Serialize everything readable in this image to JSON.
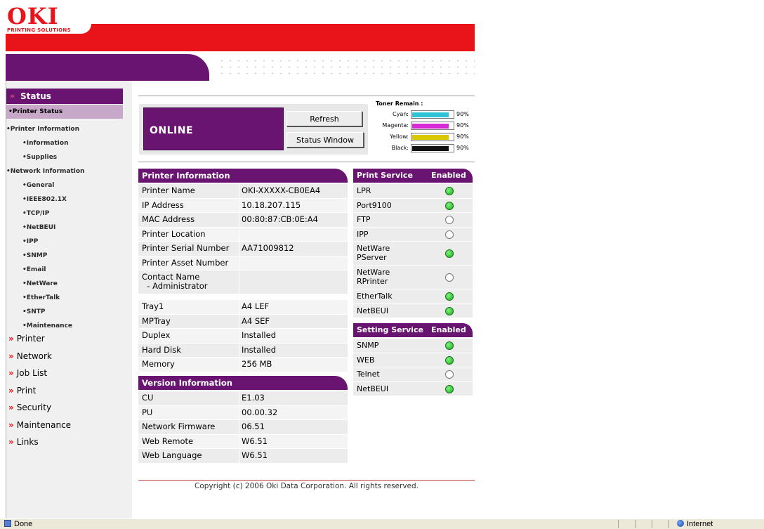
{
  "brand": {
    "logo_text": "OKI",
    "logo_sub": "PRINTING SOLUTIONS"
  },
  "sidebar": {
    "status_label": "Status",
    "printer_status": "•Printer Status",
    "subitems": [
      {
        "label": "•Printer Information",
        "indent": 0
      },
      {
        "label": "•Information",
        "indent": 1
      },
      {
        "label": "•Supplies",
        "indent": 1
      },
      {
        "label": "•Network Information",
        "indent": 0
      },
      {
        "label": "•General",
        "indent": 1
      },
      {
        "label": "•IEEE802.1X",
        "indent": 1
      },
      {
        "label": "•TCP/IP",
        "indent": 1
      },
      {
        "label": "•NetBEUI",
        "indent": 1
      },
      {
        "label": "•IPP",
        "indent": 1
      },
      {
        "label": "•SNMP",
        "indent": 1
      },
      {
        "label": "•Email",
        "indent": 1
      },
      {
        "label": "•NetWare",
        "indent": 1
      },
      {
        "label": "•EtherTalk",
        "indent": 1
      },
      {
        "label": "•SNTP",
        "indent": 1
      },
      {
        "label": "•Maintenance",
        "indent": 1
      }
    ],
    "main_items": [
      "Printer",
      "Network",
      "Job List",
      "Print",
      "Security",
      "Maintenance",
      "Links"
    ],
    "chevron": "»"
  },
  "status": {
    "state": "ONLINE",
    "refresh_label": "Refresh",
    "status_window_label": "Status Window"
  },
  "toner": {
    "title": "Toner Remain :",
    "items": [
      {
        "name": "Cyan:",
        "level": 90,
        "pct": "90%",
        "color": "#2ec3d6"
      },
      {
        "name": "Magenta:",
        "level": 90,
        "pct": "90%",
        "color": "#d62ad6"
      },
      {
        "name": "Yellow:",
        "level": 90,
        "pct": "90%",
        "color": "#d8c800"
      },
      {
        "name": "Black:",
        "level": 90,
        "pct": "90%",
        "color": "#111111"
      }
    ]
  },
  "printer_info": {
    "title": "Printer Information",
    "rows": [
      [
        "Printer Name",
        "OKI-XXXXX-CB0EA4"
      ],
      [
        "IP Address",
        "10.18.207.115"
      ],
      [
        "MAC Address",
        "00:80:87:CB:0E:A4"
      ],
      [
        "Printer Location",
        ""
      ],
      [
        "Printer Serial Number",
        "AA71009812"
      ],
      [
        "Printer Asset Number",
        ""
      ],
      [
        "Contact Name\n  - Administrator",
        ""
      ],
      [
        "Tray1",
        "A4 LEF"
      ],
      [
        "MPTray",
        "A4 SEF"
      ],
      [
        "Duplex",
        "Installed"
      ],
      [
        "Hard Disk",
        "Installed"
      ],
      [
        "Memory",
        "256 MB"
      ]
    ]
  },
  "version_info": {
    "title": "Version Information",
    "rows": [
      [
        "CU",
        "E1.03"
      ],
      [
        "PU",
        "00.00.32"
      ],
      [
        "Network Firmware",
        "06.51"
      ],
      [
        "Web Remote",
        "W6.51"
      ],
      [
        "Web Language",
        "W6.51"
      ]
    ]
  },
  "print_service": {
    "title": "Print Service",
    "enabled_label": "Enabled",
    "rows": [
      {
        "name": "LPR",
        "enabled": true
      },
      {
        "name": "Port9100",
        "enabled": true
      },
      {
        "name": "FTP",
        "enabled": false
      },
      {
        "name": "IPP",
        "enabled": false
      },
      {
        "name": "NetWare\nPServer",
        "enabled": true
      },
      {
        "name": "NetWare\nRPrinter",
        "enabled": false
      },
      {
        "name": "EtherTalk",
        "enabled": true
      },
      {
        "name": "NetBEUI",
        "enabled": true
      }
    ]
  },
  "setting_service": {
    "title": "Setting Service",
    "enabled_label": "Enabled",
    "rows": [
      {
        "name": "SNMP",
        "enabled": true
      },
      {
        "name": "WEB",
        "enabled": true
      },
      {
        "name": "Telnet",
        "enabled": false
      },
      {
        "name": "NetBEUI",
        "enabled": true
      }
    ]
  },
  "footer": {
    "copyright": "Copyright (c) 2006 Oki Data Corporation. All rights reserved."
  },
  "statusbar": {
    "left": "Done",
    "zone": "Internet"
  }
}
